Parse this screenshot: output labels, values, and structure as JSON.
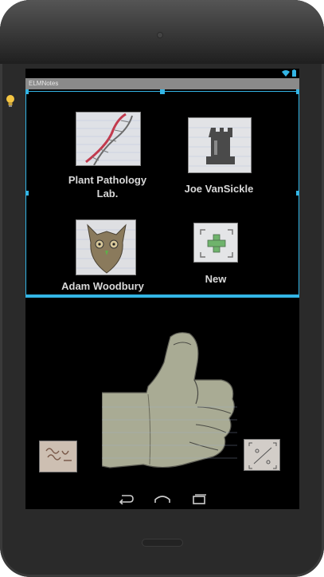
{
  "app": {
    "title": "ELMNotes"
  },
  "grid": {
    "items": [
      {
        "label": "Plant Pathology Lab.",
        "icon": "dna-sketch-icon"
      },
      {
        "label": "Joe VanSickle",
        "icon": "rook-sketch-icon"
      },
      {
        "label": "Adam Woodbury",
        "icon": "owl-sketch-icon"
      },
      {
        "label": "New",
        "icon": "add-note-icon"
      }
    ]
  },
  "bottom": {
    "thumb_icon": "thumbs-up-sketch-icon",
    "left_card_icon": "notes-sketch-icon",
    "right_card_icon": "pattern-sketch-icon"
  },
  "navbar": {
    "buttons": [
      "back-icon",
      "home-icon",
      "recents-icon"
    ]
  },
  "colors": {
    "selection": "#33b5e5",
    "screen_bg": "#000000",
    "label_text": "#d8d8d8"
  }
}
